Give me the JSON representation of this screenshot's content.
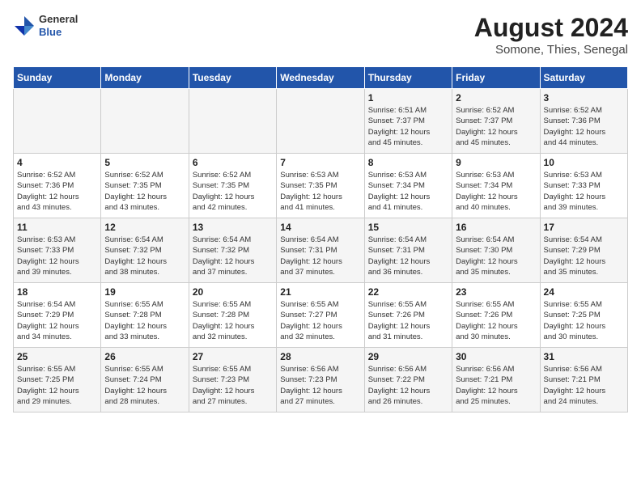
{
  "header": {
    "logo": {
      "general": "General",
      "blue": "Blue"
    },
    "title": "August 2024",
    "location": "Somone, Thies, Senegal"
  },
  "weekdays": [
    "Sunday",
    "Monday",
    "Tuesday",
    "Wednesday",
    "Thursday",
    "Friday",
    "Saturday"
  ],
  "weeks": [
    [
      {
        "day": "",
        "info": ""
      },
      {
        "day": "",
        "info": ""
      },
      {
        "day": "",
        "info": ""
      },
      {
        "day": "",
        "info": ""
      },
      {
        "day": "1",
        "info": "Sunrise: 6:51 AM\nSunset: 7:37 PM\nDaylight: 12 hours\nand 45 minutes."
      },
      {
        "day": "2",
        "info": "Sunrise: 6:52 AM\nSunset: 7:37 PM\nDaylight: 12 hours\nand 45 minutes."
      },
      {
        "day": "3",
        "info": "Sunrise: 6:52 AM\nSunset: 7:36 PM\nDaylight: 12 hours\nand 44 minutes."
      }
    ],
    [
      {
        "day": "4",
        "info": "Sunrise: 6:52 AM\nSunset: 7:36 PM\nDaylight: 12 hours\nand 43 minutes."
      },
      {
        "day": "5",
        "info": "Sunrise: 6:52 AM\nSunset: 7:35 PM\nDaylight: 12 hours\nand 43 minutes."
      },
      {
        "day": "6",
        "info": "Sunrise: 6:52 AM\nSunset: 7:35 PM\nDaylight: 12 hours\nand 42 minutes."
      },
      {
        "day": "7",
        "info": "Sunrise: 6:53 AM\nSunset: 7:35 PM\nDaylight: 12 hours\nand 41 minutes."
      },
      {
        "day": "8",
        "info": "Sunrise: 6:53 AM\nSunset: 7:34 PM\nDaylight: 12 hours\nand 41 minutes."
      },
      {
        "day": "9",
        "info": "Sunrise: 6:53 AM\nSunset: 7:34 PM\nDaylight: 12 hours\nand 40 minutes."
      },
      {
        "day": "10",
        "info": "Sunrise: 6:53 AM\nSunset: 7:33 PM\nDaylight: 12 hours\nand 39 minutes."
      }
    ],
    [
      {
        "day": "11",
        "info": "Sunrise: 6:53 AM\nSunset: 7:33 PM\nDaylight: 12 hours\nand 39 minutes."
      },
      {
        "day": "12",
        "info": "Sunrise: 6:54 AM\nSunset: 7:32 PM\nDaylight: 12 hours\nand 38 minutes."
      },
      {
        "day": "13",
        "info": "Sunrise: 6:54 AM\nSunset: 7:32 PM\nDaylight: 12 hours\nand 37 minutes."
      },
      {
        "day": "14",
        "info": "Sunrise: 6:54 AM\nSunset: 7:31 PM\nDaylight: 12 hours\nand 37 minutes."
      },
      {
        "day": "15",
        "info": "Sunrise: 6:54 AM\nSunset: 7:31 PM\nDaylight: 12 hours\nand 36 minutes."
      },
      {
        "day": "16",
        "info": "Sunrise: 6:54 AM\nSunset: 7:30 PM\nDaylight: 12 hours\nand 35 minutes."
      },
      {
        "day": "17",
        "info": "Sunrise: 6:54 AM\nSunset: 7:29 PM\nDaylight: 12 hours\nand 35 minutes."
      }
    ],
    [
      {
        "day": "18",
        "info": "Sunrise: 6:54 AM\nSunset: 7:29 PM\nDaylight: 12 hours\nand 34 minutes."
      },
      {
        "day": "19",
        "info": "Sunrise: 6:55 AM\nSunset: 7:28 PM\nDaylight: 12 hours\nand 33 minutes."
      },
      {
        "day": "20",
        "info": "Sunrise: 6:55 AM\nSunset: 7:28 PM\nDaylight: 12 hours\nand 32 minutes."
      },
      {
        "day": "21",
        "info": "Sunrise: 6:55 AM\nSunset: 7:27 PM\nDaylight: 12 hours\nand 32 minutes."
      },
      {
        "day": "22",
        "info": "Sunrise: 6:55 AM\nSunset: 7:26 PM\nDaylight: 12 hours\nand 31 minutes."
      },
      {
        "day": "23",
        "info": "Sunrise: 6:55 AM\nSunset: 7:26 PM\nDaylight: 12 hours\nand 30 minutes."
      },
      {
        "day": "24",
        "info": "Sunrise: 6:55 AM\nSunset: 7:25 PM\nDaylight: 12 hours\nand 30 minutes."
      }
    ],
    [
      {
        "day": "25",
        "info": "Sunrise: 6:55 AM\nSunset: 7:25 PM\nDaylight: 12 hours\nand 29 minutes."
      },
      {
        "day": "26",
        "info": "Sunrise: 6:55 AM\nSunset: 7:24 PM\nDaylight: 12 hours\nand 28 minutes."
      },
      {
        "day": "27",
        "info": "Sunrise: 6:55 AM\nSunset: 7:23 PM\nDaylight: 12 hours\nand 27 minutes."
      },
      {
        "day": "28",
        "info": "Sunrise: 6:56 AM\nSunset: 7:23 PM\nDaylight: 12 hours\nand 27 minutes."
      },
      {
        "day": "29",
        "info": "Sunrise: 6:56 AM\nSunset: 7:22 PM\nDaylight: 12 hours\nand 26 minutes."
      },
      {
        "day": "30",
        "info": "Sunrise: 6:56 AM\nSunset: 7:21 PM\nDaylight: 12 hours\nand 25 minutes."
      },
      {
        "day": "31",
        "info": "Sunrise: 6:56 AM\nSunset: 7:21 PM\nDaylight: 12 hours\nand 24 minutes."
      }
    ]
  ]
}
